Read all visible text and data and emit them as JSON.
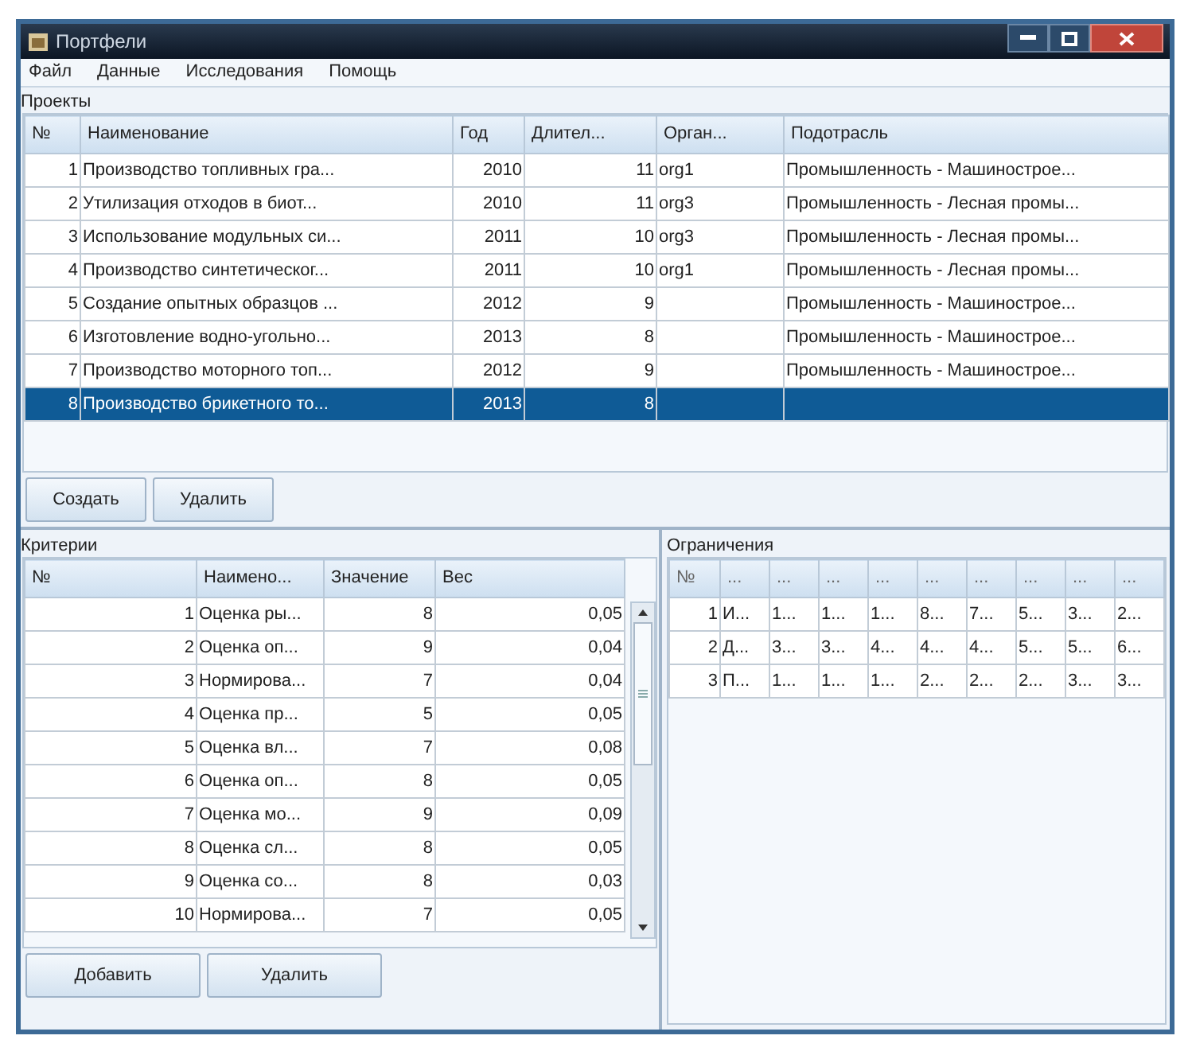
{
  "window": {
    "title": "Портфели"
  },
  "menu": [
    "Файл",
    "Данные",
    "Исследования",
    "Помощь"
  ],
  "projects": {
    "label": "Проекты",
    "columns": [
      "№",
      "Наименование",
      "Год",
      "Длител...",
      "Орган...",
      "Подотрасль"
    ],
    "rows": [
      {
        "cells": [
          "1",
          "Производство топливных гра...",
          "2010",
          "11",
          "org1",
          "Промышленность - Машиностроe..."
        ],
        "selected": false
      },
      {
        "cells": [
          "2",
          "Утилизация отходов в биот...",
          "2010",
          "11",
          "org3",
          "Промышленность - Лесная промы..."
        ],
        "selected": false
      },
      {
        "cells": [
          "3",
          "Использование модульных си...",
          "2011",
          "10",
          "org3",
          "Промышленность - Лесная промы..."
        ],
        "selected": false
      },
      {
        "cells": [
          "4",
          "Производство синтетическог...",
          "2011",
          "10",
          "org1",
          "Промышленность - Лесная промы..."
        ],
        "selected": false
      },
      {
        "cells": [
          "5",
          "Создание опытных образцов ...",
          "2012",
          "9",
          "",
          "Промышленность - Машиностроe..."
        ],
        "selected": false
      },
      {
        "cells": [
          "6",
          "Изготовление водно-угольно...",
          "2013",
          "8",
          "",
          "Промышленность - Машиностроe..."
        ],
        "selected": false
      },
      {
        "cells": [
          "7",
          "Производство моторного топ...",
          "2012",
          "9",
          "",
          "Промышленность - Машиностроe..."
        ],
        "selected": false
      },
      {
        "cells": [
          "8",
          "Производство брикетного то...",
          "2013",
          "8",
          "",
          ""
        ],
        "selected": true
      }
    ],
    "buttons": [
      "Создать",
      "Удалить"
    ]
  },
  "criteria": {
    "label": "Критерии",
    "columns": [
      "№",
      "Наимено...",
      "Значение",
      "Вес"
    ],
    "rows": [
      [
        "1",
        "Оценка ры...",
        "8",
        "0,05"
      ],
      [
        "2",
        "Оценка оп...",
        "9",
        "0,04"
      ],
      [
        "3",
        "Нормирова...",
        "7",
        "0,04"
      ],
      [
        "4",
        "Оценка пр...",
        "5",
        "0,05"
      ],
      [
        "5",
        "Оценка вл...",
        "7",
        "0,08"
      ],
      [
        "6",
        "Оценка оп...",
        "8",
        "0,05"
      ],
      [
        "7",
        "Оценка мо...",
        "9",
        "0,09"
      ],
      [
        "8",
        "Оценка сл...",
        "8",
        "0,05"
      ],
      [
        "9",
        "Оценка со...",
        "8",
        "0,03"
      ],
      [
        "10",
        "Нормирова...",
        "7",
        "0,05"
      ]
    ],
    "buttons": [
      "Добавить",
      "Удалить"
    ]
  },
  "constraints": {
    "label": "Ограничения",
    "columns": [
      "№",
      "...",
      "...",
      "...",
      "...",
      "...",
      "...",
      "...",
      "...",
      "..."
    ],
    "rows": [
      [
        "1",
        "И...",
        "1...",
        "1...",
        "1...",
        "8...",
        "7...",
        "5...",
        "3...",
        "2..."
      ],
      [
        "2",
        "Д...",
        "3...",
        "3...",
        "4...",
        "4...",
        "4...",
        "5...",
        "5...",
        "6..."
      ],
      [
        "3",
        "П...",
        "1...",
        "1...",
        "1...",
        "2...",
        "2...",
        "2...",
        "3...",
        "3..."
      ]
    ]
  }
}
